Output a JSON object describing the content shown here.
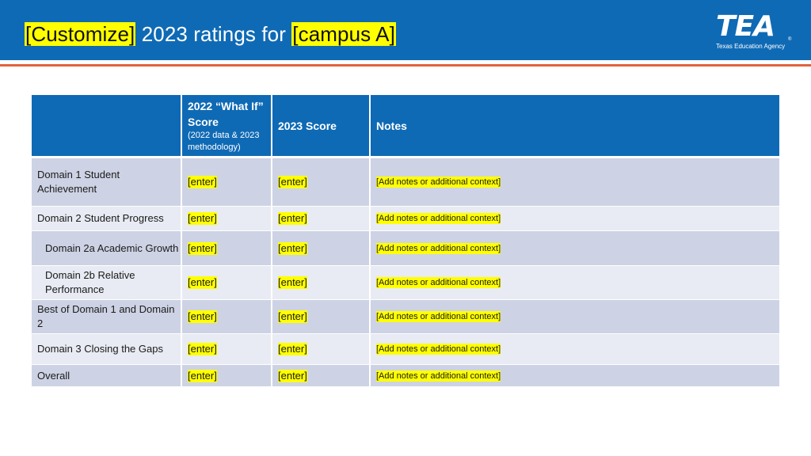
{
  "header": {
    "title_prefix": "[Customize]",
    "title_middle": " 2023 ratings for ",
    "title_suffix": "[campus A]",
    "logo": {
      "mark": "TEA",
      "subtitle": "Texas Education Agency",
      "registered": "®"
    },
    "colors": {
      "band": "#0f6ab5",
      "accent_line": "#e0633f",
      "highlight": "#ffff00"
    }
  },
  "table": {
    "columns": [
      {
        "label": ""
      },
      {
        "label": "2022 “What If” Score",
        "sublabel": "(2022 data & 2023 methodology)"
      },
      {
        "label": "2023 Score"
      },
      {
        "label": "Notes"
      }
    ],
    "rows": [
      {
        "label": "Domain 1 Student Achievement",
        "what_if": "[enter]",
        "score_2023": "[enter]",
        "notes": "[Add notes or additional context]"
      },
      {
        "label": "Domain 2 Student Progress",
        "what_if": "[enter]",
        "score_2023": "[enter]",
        "notes": "[Add notes or additional context]"
      },
      {
        "label": "Domain 2a Academic Growth",
        "what_if": "[enter]",
        "score_2023": "[enter]",
        "notes": "[Add notes or additional context]"
      },
      {
        "label": "Domain 2b Relative Performance",
        "what_if": "[enter]",
        "score_2023": "[enter]",
        "notes": "[Add notes or additional context]"
      },
      {
        "label": "Best of Domain 1 and Domain 2",
        "what_if": "[enter]",
        "score_2023": "[enter]",
        "notes": "[Add notes or additional context]"
      },
      {
        "label": "Domain 3 Closing the Gaps",
        "what_if": "[enter]",
        "score_2023": "[enter]",
        "notes": "[Add notes or additional context]"
      },
      {
        "label": "Overall",
        "what_if": "[enter]",
        "score_2023": "[enter]",
        "notes": "[Add notes or additional context]"
      }
    ]
  }
}
